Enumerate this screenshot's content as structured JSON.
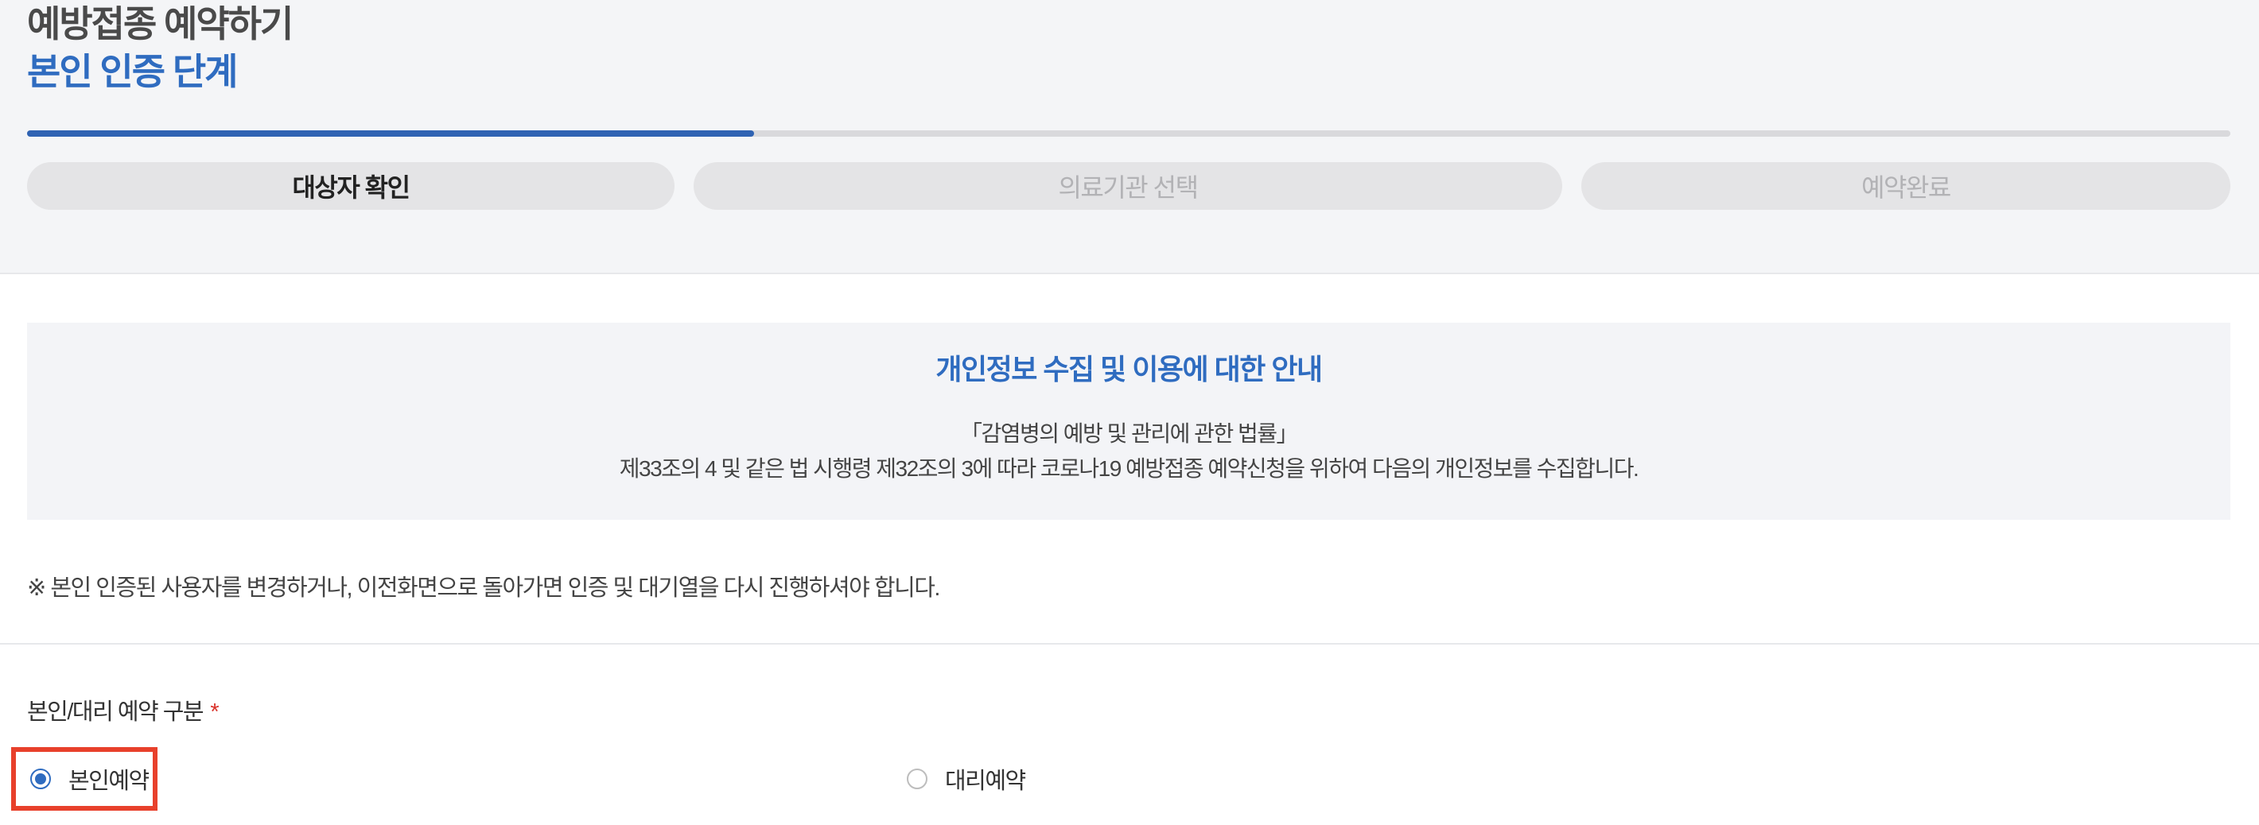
{
  "header": {
    "title": "예방접종 예약하기",
    "subtitle": "본인 인증 단계",
    "progress_fraction": 0.33,
    "steps": [
      {
        "label": "대상자 확인",
        "active": true
      },
      {
        "label": "의료기관 선택",
        "active": false
      },
      {
        "label": "예약완료",
        "active": false
      }
    ]
  },
  "info": {
    "title": "개인정보 수집 및 이용에 대한 안내",
    "line1": "「감염병의 예방 및 관리에 관한 법률」",
    "line2": "제33조의 4 및 같은 법 시행령 제32조의 3에 따라 코로나19 예방접종 예약신청을 위하여 다음의 개인정보를 수집합니다."
  },
  "notice": "※ 본인 인증된 사용자를 변경하거나, 이전화면으로 돌아가면 인증 및 대기열을 다시 진행하셔야 합니다.",
  "form": {
    "label": "본인/대리 예약 구분",
    "required": "*",
    "options": [
      {
        "label": "본인예약",
        "checked": true
      },
      {
        "label": "대리예약",
        "checked": false
      }
    ]
  },
  "colors": {
    "accent": "#2f6cc0",
    "progress": "#2f63b3",
    "highlight_border": "#e8402b",
    "required": "#d9322a"
  }
}
